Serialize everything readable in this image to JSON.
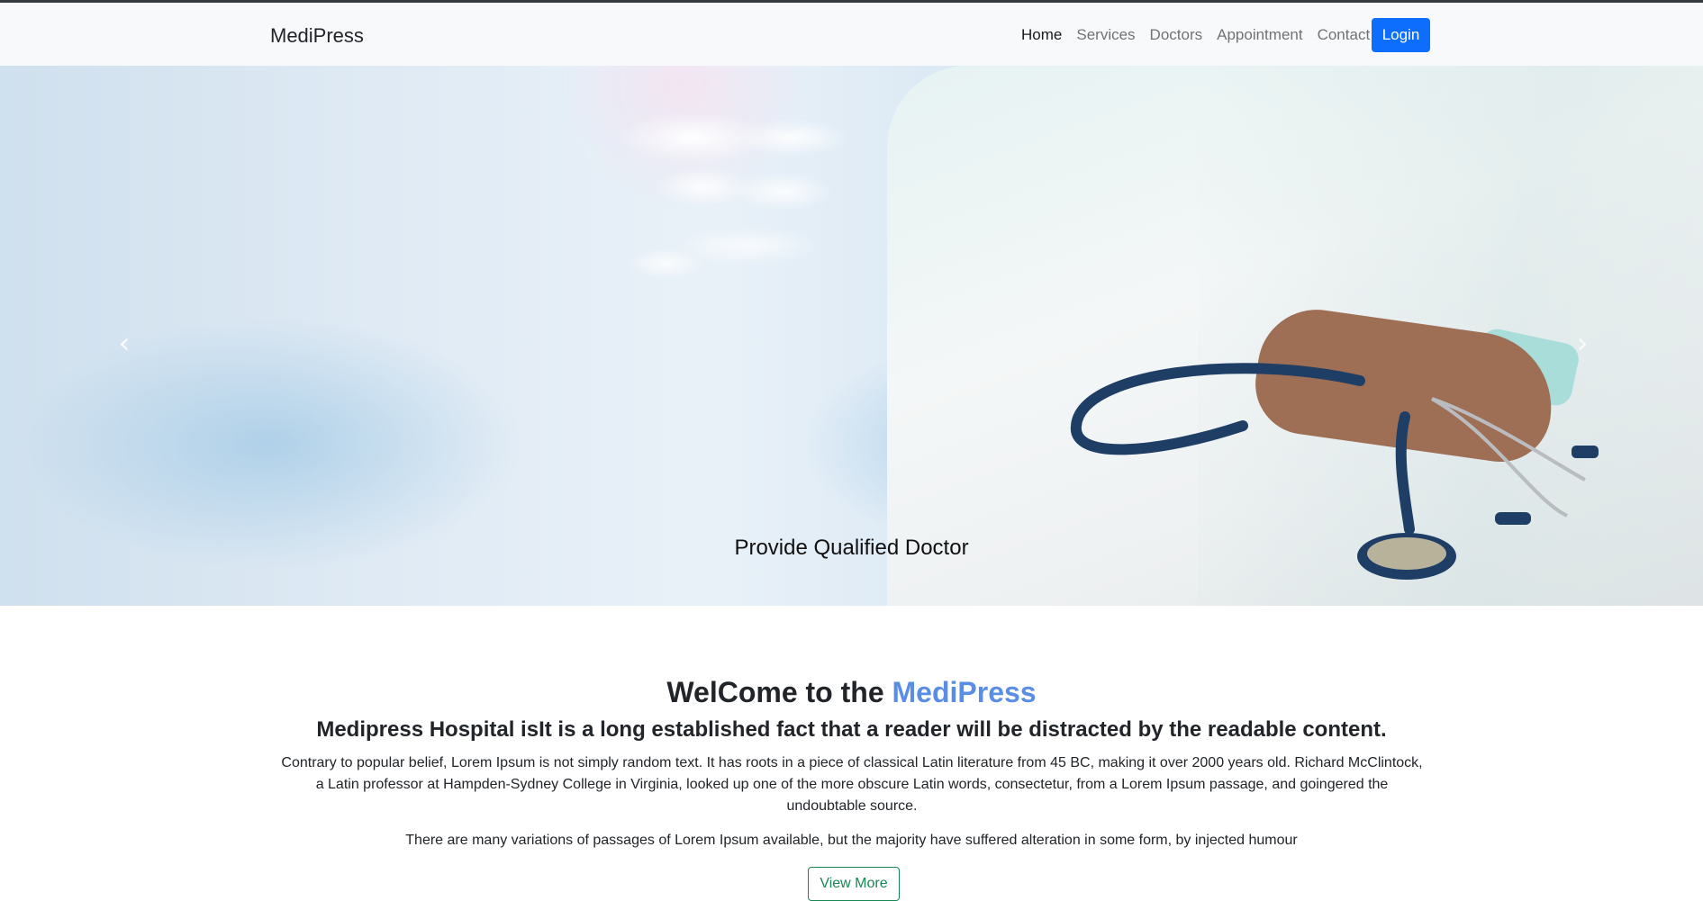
{
  "navbar": {
    "brand": "MediPress",
    "links": [
      {
        "label": "Home",
        "active": true
      },
      {
        "label": "Services",
        "active": false
      },
      {
        "label": "Doctors",
        "active": false
      },
      {
        "label": "Appointment",
        "active": false
      },
      {
        "label": "Contact",
        "active": false
      }
    ],
    "login_label": "Login"
  },
  "hero": {
    "caption": "Provide Qualified Doctor",
    "prev_icon": "chevron-left-icon",
    "next_icon": "chevron-right-icon"
  },
  "welcome": {
    "title_prefix": "WelCome to the ",
    "title_accent": "MediPress",
    "subtitle": "Medipress Hospital isIt is a long established fact that a reader will be distracted by the readable content.",
    "paragraph1": "Contrary to popular belief, Lorem Ipsum is not simply random text. It has roots in a piece of classical Latin literature from 45 BC, making it over 2000 years old. Richard McClintock, a Latin professor at Hampden-Sydney College in Virginia, looked up one of the more obscure Latin words, consectetur, from a Lorem Ipsum passage, and goingered the undoubtable source.",
    "paragraph2": "There are many variations of passages of Lorem Ipsum available, but the majority have suffered alteration in some form, by injected humour",
    "button_label": "View More"
  },
  "colors": {
    "primary": "#0d6efd",
    "accent": "#5a8ee6",
    "success": "#198754",
    "navbar_bg": "#f8f9fa"
  }
}
